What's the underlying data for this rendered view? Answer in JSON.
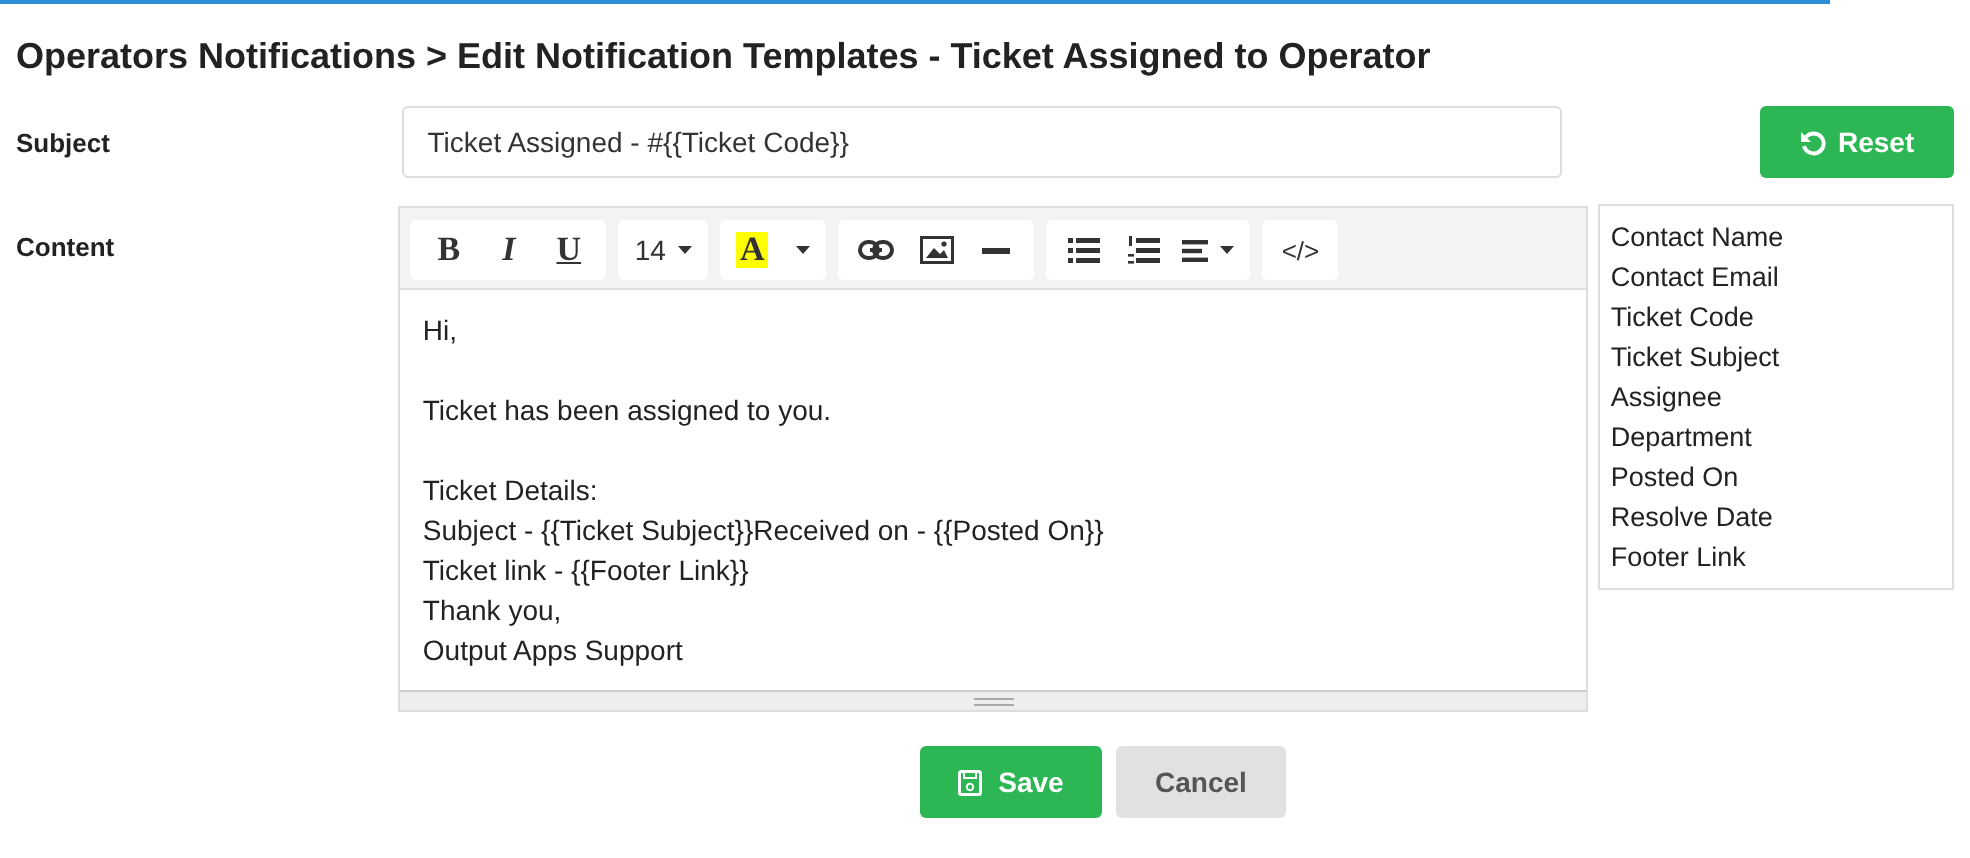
{
  "page": {
    "title": "Operators Notifications > Edit Notification Templates - Ticket Assigned to Operator"
  },
  "subject": {
    "label": "Subject",
    "value": "Ticket Assigned - #{{Ticket Code}}"
  },
  "reset_button": {
    "label": "Reset"
  },
  "content": {
    "label": "Content"
  },
  "toolbar": [
    [
      {
        "kind": "bold",
        "label": "B"
      },
      {
        "kind": "italic",
        "label": "I"
      },
      {
        "kind": "underline",
        "label": "U"
      }
    ],
    [
      {
        "kind": "fontsize",
        "label": "14"
      }
    ],
    [
      {
        "kind": "color",
        "label": "A"
      }
    ],
    [
      {
        "kind": "link"
      },
      {
        "kind": "image"
      },
      {
        "kind": "rule"
      }
    ],
    [
      {
        "kind": "ul"
      },
      {
        "kind": "ol"
      },
      {
        "kind": "align"
      }
    ],
    [
      {
        "kind": "code",
        "label": "</>"
      }
    ]
  ],
  "editor_blocks": [
    [
      "Hi,"
    ],
    [
      "Ticket has been assigned to you."
    ],
    [
      "Ticket Details:",
      "Subject - {{Ticket Subject}}Received on - {{Posted On}}",
      "Ticket link - {{Footer Link}}",
      "Thank you,",
      "Output Apps Support"
    ]
  ],
  "variables": [
    "Contact Name",
    "Contact Email",
    "Ticket Code",
    "Ticket Subject",
    "Assignee",
    "Department",
    "Posted On",
    "Resolve Date",
    "Footer Link"
  ],
  "buttons": [
    {
      "kind": "save",
      "label": "Save"
    },
    {
      "kind": "cancel",
      "label": "Cancel"
    }
  ]
}
